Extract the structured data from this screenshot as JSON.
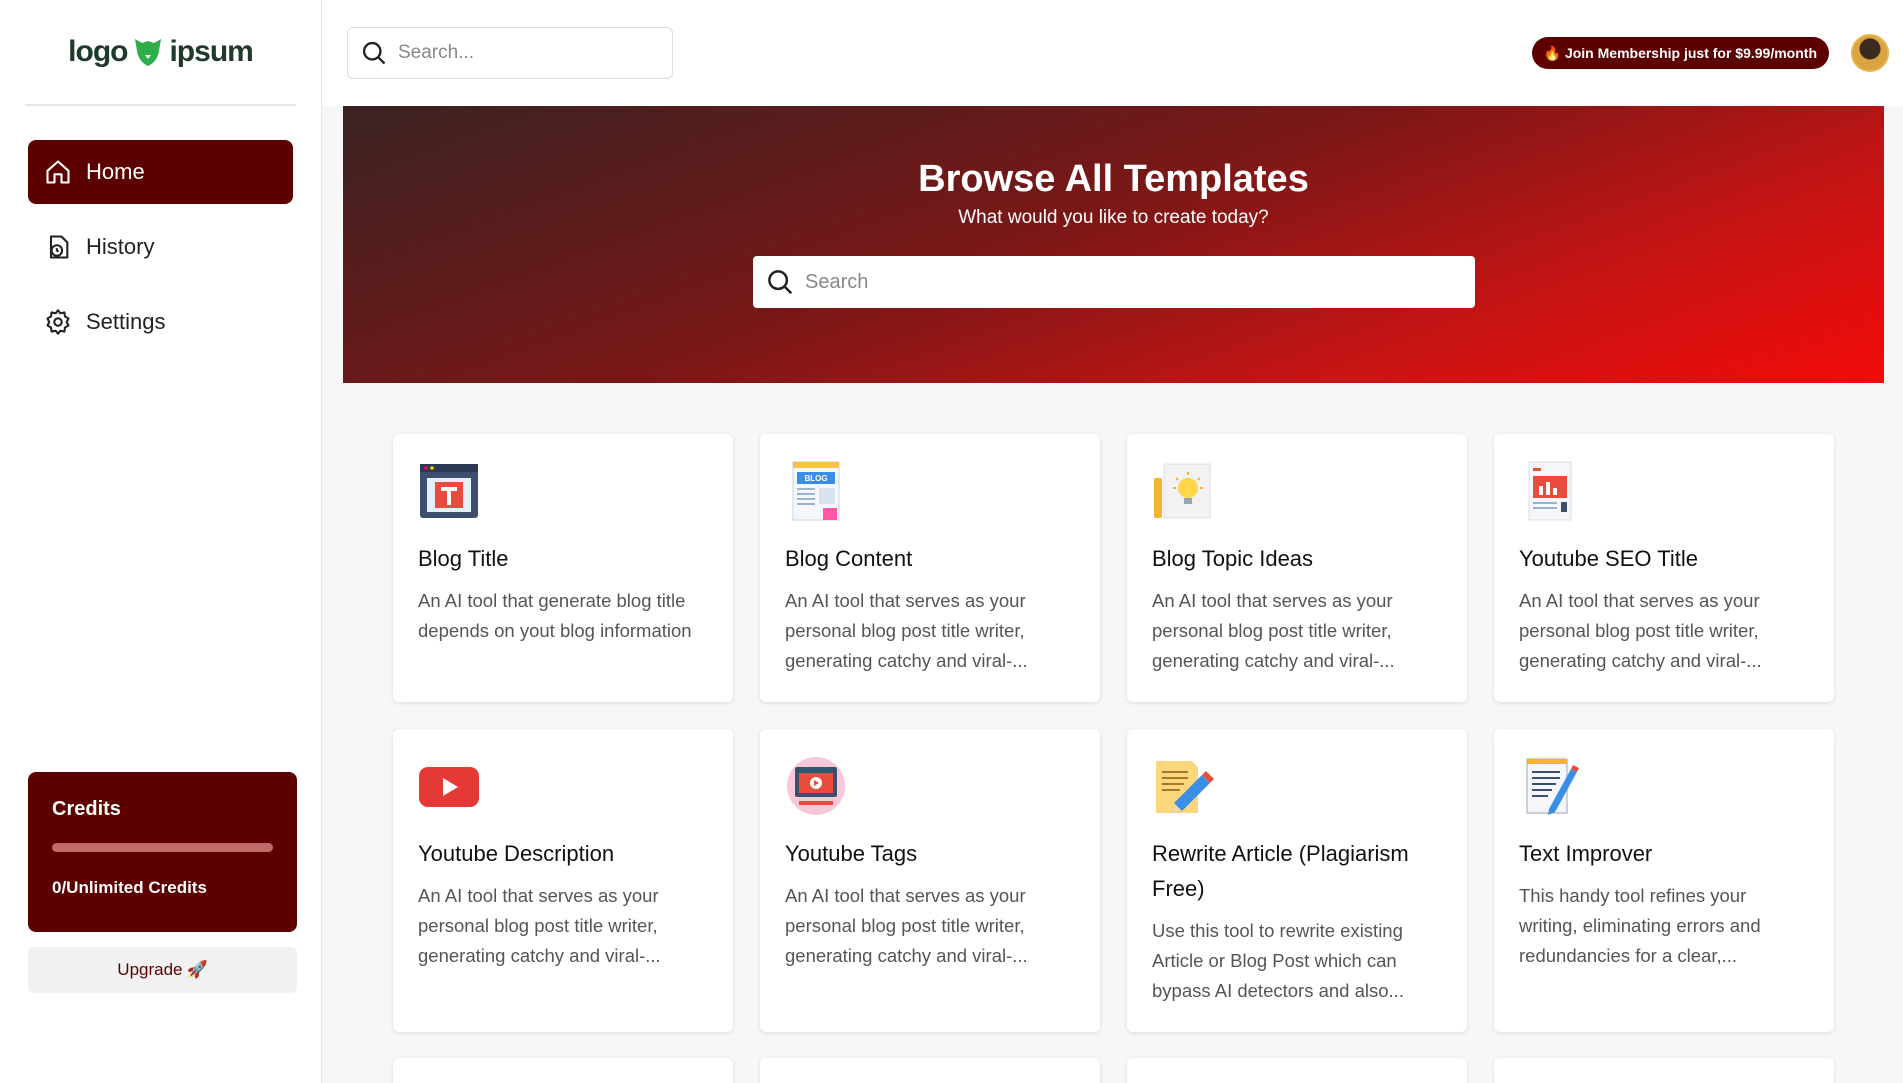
{
  "brand": {
    "logo_left": "logo",
    "logo_right": "ipsum"
  },
  "sidebar": {
    "items": [
      {
        "label": "Home",
        "icon": "home-icon",
        "active": true
      },
      {
        "label": "History",
        "icon": "history-icon",
        "active": false
      },
      {
        "label": "Settings",
        "icon": "settings-icon",
        "active": false
      }
    ],
    "credits": {
      "title": "Credits",
      "text": "0/Unlimited Credits",
      "progress": 1.0
    },
    "upgrade_label": "Upgrade",
    "upgrade_emoji": "🚀"
  },
  "header": {
    "search_placeholder": "Search...",
    "membership_label": "Join Membership just for $9.99/month",
    "membership_icon": "🔥"
  },
  "banner": {
    "title": "Browse All Templates",
    "subtitle": "What would you like to create today?",
    "search_placeholder": "Search"
  },
  "cards": [
    {
      "title": "Blog Title",
      "desc": "An AI tool that generate blog title depends on yout blog information",
      "icon": "blog-title-icon"
    },
    {
      "title": "Blog Content",
      "desc": "An AI tool that serves as your personal blog post title writer, generating catchy and viral-...",
      "icon": "blog-content-icon"
    },
    {
      "title": "Blog Topic Ideas",
      "desc": "An AI tool that serves as your personal blog post title writer, generating catchy and viral-...",
      "icon": "blog-topic-icon"
    },
    {
      "title": "Youtube SEO Title",
      "desc": "An AI tool that serves as your personal blog post title writer, generating catchy and viral-...",
      "icon": "youtube-seo-icon"
    },
    {
      "title": "Youtube Description",
      "desc": "An AI tool that serves as your personal blog post title writer, generating catchy and viral-...",
      "icon": "youtube-play-icon"
    },
    {
      "title": "Youtube Tags",
      "desc": "An AI tool that serves as your personal blog post title writer, generating catchy and viral-...",
      "icon": "youtube-tags-icon"
    },
    {
      "title": "Rewrite Article (Plagiarism Free)",
      "desc": "Use this tool to rewrite existing Article or Blog Post which can bypass AI detectors and also...",
      "icon": "rewrite-icon"
    },
    {
      "title": "Text Improver",
      "desc": "This handy tool refines your writing, eliminating errors and redundancies for a clear,...",
      "icon": "text-improver-icon"
    }
  ],
  "colors": {
    "primary": "#5c0000",
    "banner_start": "#3a2222",
    "banner_end": "#f20a0a"
  }
}
